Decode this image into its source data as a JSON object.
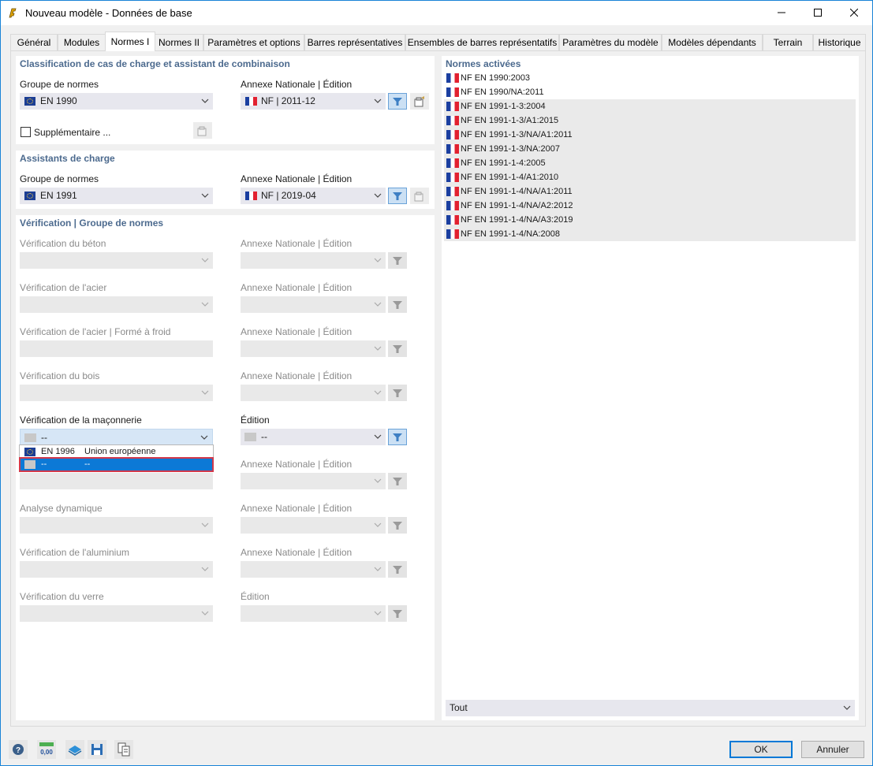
{
  "window": {
    "title": "Nouveau modèle - Données de base",
    "app_icon": "rfem-icon",
    "controls": [
      "minimize-icon",
      "maximize-icon",
      "close-icon"
    ]
  },
  "tabs": [
    {
      "label": "Général"
    },
    {
      "label": "Modules"
    },
    {
      "label": "Normes I",
      "active": true
    },
    {
      "label": "Normes II"
    },
    {
      "label": "Paramètres et options"
    },
    {
      "label": "Barres représentatives"
    },
    {
      "label": "Ensembles de barres représentatifs"
    },
    {
      "label": "Paramètres du modèle"
    },
    {
      "label": "Modèles dépendants"
    },
    {
      "label": "Terrain"
    },
    {
      "label": "Historique"
    }
  ],
  "classification": {
    "title": "Classification de cas de charge et assistant de combinaison",
    "group_label": "Groupe de normes",
    "group_value": "EN 1990",
    "annex_label": "Annexe Nationale | Édition",
    "annex_value": "NF | 2011-12",
    "supplementary_label": "Supplémentaire ...",
    "supplementary_checked": false
  },
  "load_wizards": {
    "title": "Assistants de charge",
    "group_label": "Groupe de normes",
    "group_value": "EN 1991",
    "annex_label": "Annexe Nationale | Édition",
    "annex_value": "NF | 2019-04"
  },
  "verification": {
    "title": "Vérification | Groupe de normes",
    "rows": [
      {
        "label": "Vérification du béton",
        "annex_label": "Annexe Nationale | Édition"
      },
      {
        "label": "Vérification de l'acier",
        "annex_label": "Annexe Nationale | Édition"
      },
      {
        "label": "Vérification de l'acier | Formé à froid",
        "annex_label": "Annexe Nationale | Édition"
      },
      {
        "label": "Vérification du bois",
        "annex_label": "Annexe Nationale | Édition"
      },
      {
        "label": "Vérification de la maçonnerie",
        "annex_label": "Édition",
        "value": "--",
        "edition_value": "--",
        "enabled": true
      },
      {
        "label": "",
        "annex_label": "Annexe Nationale | Édition"
      },
      {
        "label": "Analyse dynamique",
        "annex_label": "Annexe Nationale | Édition"
      },
      {
        "label": "Vérification de l'aluminium",
        "annex_label": "Annexe Nationale | Édition"
      },
      {
        "label": "Vérification du verre",
        "annex_label": "Édition"
      }
    ],
    "dropdown_options": [
      {
        "code": "EN 1996",
        "desc": "Union européenne",
        "selected": false
      },
      {
        "code": "--",
        "desc": "--",
        "selected": true
      }
    ]
  },
  "active_standards": {
    "title": "Normes activées",
    "items": [
      {
        "text": "NF EN 1990:2003",
        "highlight": false
      },
      {
        "text": "NF EN 1990/NA:2011",
        "highlight": false
      },
      {
        "text": "NF EN 1991-1-3:2004",
        "highlight": true
      },
      {
        "text": "NF EN 1991-1-3/A1:2015",
        "highlight": true
      },
      {
        "text": "NF EN 1991-1-3/NA/A1:2011",
        "highlight": true
      },
      {
        "text": "NF EN 1991-1-3/NA:2007",
        "highlight": true
      },
      {
        "text": "NF EN 1991-1-4:2005",
        "highlight": true
      },
      {
        "text": "NF EN 1991-1-4/A1:2010",
        "highlight": true
      },
      {
        "text": "NF EN 1991-1-4/NA/A1:2011",
        "highlight": true
      },
      {
        "text": "NF EN 1991-1-4/NA/A2:2012",
        "highlight": true
      },
      {
        "text": "NF EN 1991-1-4/NA/A3:2019",
        "highlight": true
      },
      {
        "text": "NF EN 1991-1-4/NA:2008",
        "highlight": true
      }
    ],
    "filter_value": "Tout"
  },
  "footer": {
    "icons": [
      "help-icon",
      "units-icon",
      "model-info-icon",
      "save-template-icon",
      "copy-icon"
    ],
    "units_icon_text": "0,00",
    "ok_label": "OK",
    "cancel_label": "Annuler"
  },
  "colors": {
    "accent": "#0078d7",
    "panel_title": "#4c6a8e",
    "selection": "#0c79d6",
    "selection_outline": "#d2394b"
  }
}
